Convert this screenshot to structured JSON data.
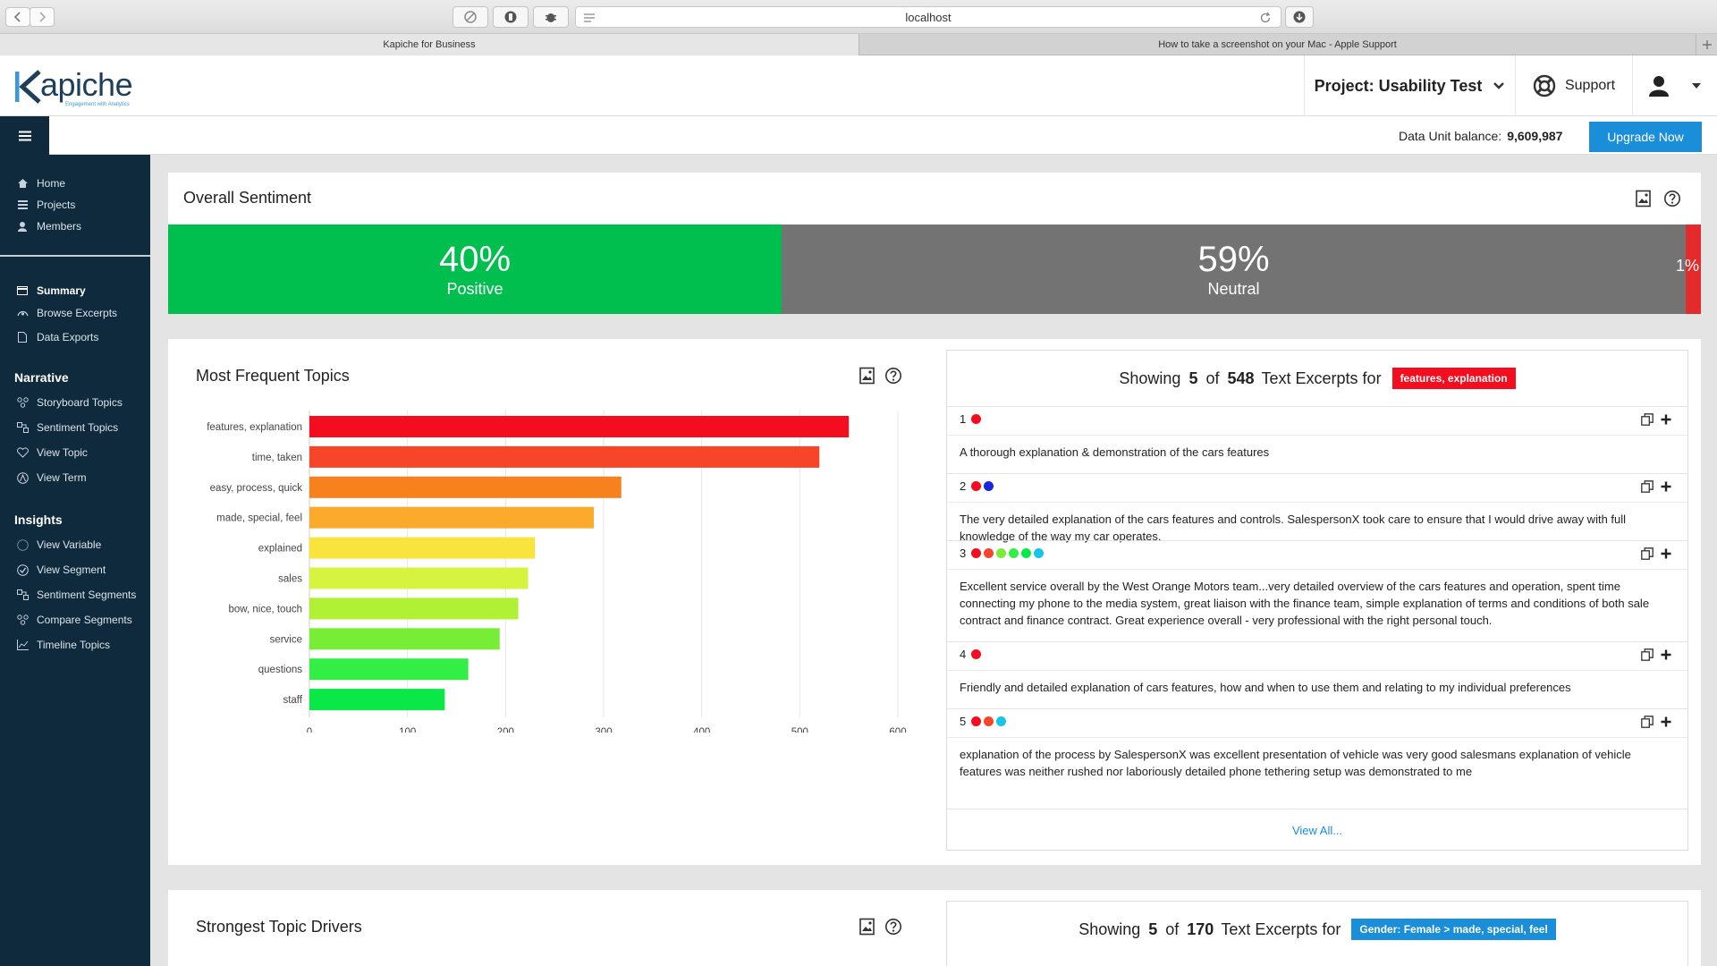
{
  "browser": {
    "url": "localhost",
    "tabs": [
      "Kapiche for Business",
      "How to take a screenshot on your Mac - Apple Support"
    ]
  },
  "header": {
    "logo": "Kapiche",
    "logo_tagline": "Engagement with Analytics",
    "project_label": "Project: Usability Test",
    "support_label": "Support",
    "balance_label": "Data Unit balance:",
    "balance_value": "9,609,987",
    "upgrade_label": "Upgrade Now"
  },
  "sidebar": {
    "top_items": [
      {
        "label": "Home",
        "icon": "home-icon"
      },
      {
        "label": "Projects",
        "icon": "list-icon"
      },
      {
        "label": "Members",
        "icon": "user-icon"
      }
    ],
    "project_items": [
      {
        "label": "Summary",
        "icon": "summary-icon"
      },
      {
        "label": "Browse Excerpts",
        "icon": "browse-icon"
      },
      {
        "label": "Data Exports",
        "icon": "file-icon"
      }
    ],
    "narrative_heading": "Narrative",
    "narrative_items": [
      {
        "label": "Storyboard Topics",
        "icon": "storyboard-icon"
      },
      {
        "label": "Sentiment Topics",
        "icon": "sentiment-icon"
      },
      {
        "label": "View Topic",
        "icon": "topic-icon"
      },
      {
        "label": "View Term",
        "icon": "term-icon"
      }
    ],
    "insights_heading": "Insights",
    "insights_items": [
      {
        "label": "View Variable",
        "icon": "variable-icon"
      },
      {
        "label": "View Segment",
        "icon": "segment-icon"
      },
      {
        "label": "Sentiment Segments",
        "icon": "sentiment-segments-icon"
      },
      {
        "label": "Compare Segments",
        "icon": "compare-icon"
      },
      {
        "label": "Timeline Topics",
        "icon": "timeline-icon"
      }
    ]
  },
  "sentiment": {
    "title": "Overall Sentiment",
    "positive": {
      "value": 40,
      "text": "40%",
      "label": "Positive",
      "color": "#00bf4e"
    },
    "neutral": {
      "value": 59,
      "text": "59%",
      "label": "Neutral",
      "color": "#737373"
    },
    "negative": {
      "value": 1,
      "text": "1%",
      "color": "#e32b2b"
    }
  },
  "topics_card": {
    "title": "Most Frequent Topics"
  },
  "chart_data": {
    "type": "bar",
    "orientation": "horizontal",
    "categories": [
      "features, explanation",
      "time, taken",
      "easy, process, quick",
      "made, special, feel",
      "explained",
      "sales",
      "bow, nice, touch",
      "service",
      "questions",
      "staff"
    ],
    "values": [
      550,
      520,
      318,
      290,
      230,
      223,
      213,
      194,
      162,
      138
    ],
    "colors": [
      "#f40d1f",
      "#f7452a",
      "#f6811d",
      "#fcaa2b",
      "#f9e43e",
      "#d6f43f",
      "#b0f136",
      "#77ee35",
      "#33ee44",
      "#0ae847"
    ],
    "xlim": [
      0,
      600
    ],
    "xticks": [
      0,
      100,
      200,
      300,
      400,
      500,
      600
    ],
    "grid": true
  },
  "excerpts": {
    "showing_prefix": "Showing",
    "count": "5",
    "of_word": "of",
    "total": "548",
    "suffix": "Text Excerpts for",
    "tag": "features, explanation",
    "tag_color": "#f40d1f",
    "items": [
      {
        "num": "1",
        "dots": [
          "#f40d1f"
        ],
        "text": "A thorough explanation & demonstration of the cars features"
      },
      {
        "num": "2",
        "dots": [
          "#f40d1f",
          "#1a26e0"
        ],
        "text": "The very detailed explanation of the cars features and controls. SalespersonX took care to ensure that I would drive away with full knowledge of the way my car operates."
      },
      {
        "num": "3",
        "dots": [
          "#f40d1f",
          "#f7452a",
          "#77ee35",
          "#33ee44",
          "#0ae847",
          "#16c5e8"
        ],
        "text": "Excellent service overall by the West Orange Motors team...very detailed overview of the cars features and operation, spent time connecting my phone to the media system, great liaison with the finance team, simple explanation of terms and conditions of both sale contract and finance contract. Great experience overall - very professional with the right personal touch."
      },
      {
        "num": "4",
        "dots": [
          "#f40d1f"
        ],
        "text": "Friendly and detailed explanation of cars features, how and when to use them and relating to my individual preferences"
      },
      {
        "num": "5",
        "dots": [
          "#f40d1f",
          "#f7452a",
          "#16c5e8"
        ],
        "text": "explanation of the process by SalespersonX was excellent presentation of vehicle was very good salesmans explanation of vehicle features was neither rushed nor laboriously detailed phone tethering setup was demonstrated to me"
      }
    ],
    "view_all": "View All..."
  },
  "drivers": {
    "title": "Strongest Topic Drivers",
    "showing_prefix": "Showing",
    "count": "5",
    "of_word": "of",
    "total": "170",
    "suffix": "Text Excerpts for",
    "tag": "Gender: Female > made, special, feel",
    "tag_color": "#1a8ed9"
  }
}
